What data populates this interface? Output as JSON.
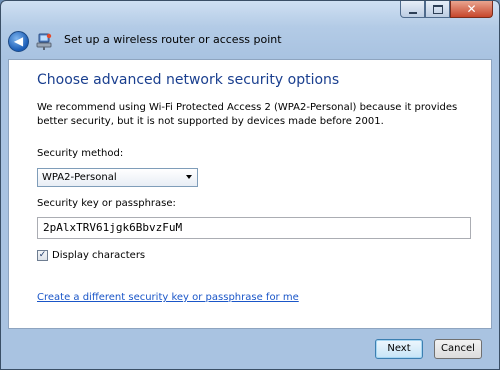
{
  "window": {
    "title": "Set up a wireless router or access point"
  },
  "page": {
    "heading": "Choose advanced network security options",
    "description": "We recommend using Wi-Fi Protected Access 2 (WPA2-Personal) because it provides better security,  but it is not supported by devices made before 2001.",
    "security_method_label": "Security method:",
    "security_method_value": "WPA2-Personal",
    "security_key_label": "Security key or passphrase:",
    "security_key_value": "2pAlxTRV61jgk6BbvzFuM",
    "display_characters_label": "Display characters",
    "display_characters_checked": true,
    "create_key_link": "Create a different security key or passphrase for me"
  },
  "buttons": {
    "next": "Next",
    "cancel": "Cancel"
  },
  "icons": {
    "back": "back-arrow-icon",
    "network": "network-setup-icon",
    "minimize": "minimize-icon",
    "maximize": "maximize-icon",
    "close": "close-icon"
  },
  "colors": {
    "heading": "#1a3f8f",
    "link": "#1a56c8",
    "frame": "#b3cbe6",
    "close_button": "#c7462b"
  }
}
